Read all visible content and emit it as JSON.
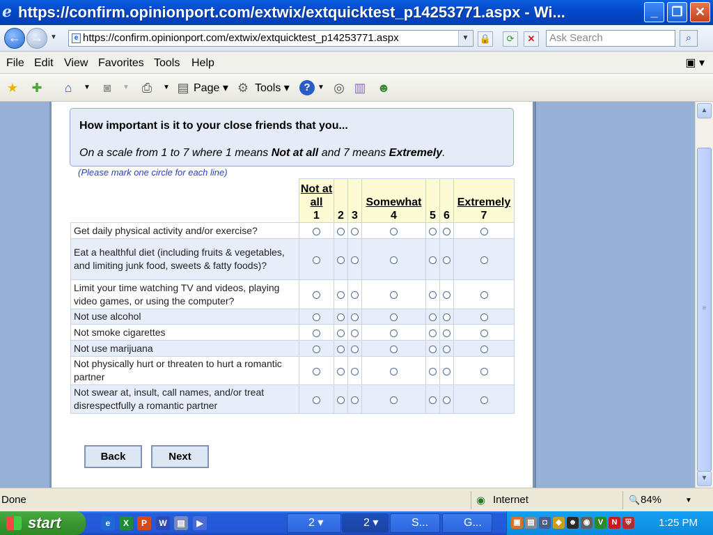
{
  "window": {
    "title": "https://confirm.opinionport.com/extwix/extquicktest_p14253771.aspx - Wi..."
  },
  "address_bar": {
    "url": "https://confirm.opinionport.com/extwix/extquicktest_p14253771.aspx",
    "search_placeholder": "Ask Search"
  },
  "menu": [
    "File",
    "Edit",
    "View",
    "Favorites",
    "Tools",
    "Help"
  ],
  "toolbar": {
    "page_label": "Page",
    "tools_label": "Tools"
  },
  "survey": {
    "question": "How important is it to your close friends that you...",
    "scale_prefix": "On a scale from 1 to 7 where 1 means ",
    "scale_low": "Not at all",
    "scale_mid": " and 7 means ",
    "scale_high": "Extremely",
    "scale_end": ".",
    "instruction": "(Please mark one circle for each line)",
    "columns": [
      {
        "label": "Not at all",
        "value": "1"
      },
      {
        "label": "",
        "value": "2"
      },
      {
        "label": "",
        "value": "3"
      },
      {
        "label": "Somewhat",
        "value": "4"
      },
      {
        "label": "",
        "value": "5"
      },
      {
        "label": "",
        "value": "6"
      },
      {
        "label": "Extremely",
        "value": "7"
      }
    ],
    "items": [
      "Get daily physical activity and/or exercise?",
      "Eat a healthful diet (including fruits & vegetables, and limiting junk food, sweets & fatty foods)?",
      "Limit your time watching TV and videos, playing video games, or using the computer?",
      "Not use alcohol",
      "Not smoke cigarettes",
      "Not use marijuana",
      "Not physically hurt or threaten to hurt a romantic partner",
      "Not swear at, insult, call names, and/or treat disrespectfully a romantic partner"
    ],
    "back_label": "Back",
    "next_label": "Next"
  },
  "status": {
    "text": "Done",
    "zone": "Internet",
    "zoom": "84%"
  },
  "taskbar": {
    "start_label": "start",
    "tasks": [
      "2",
      "2",
      "S...",
      "G..."
    ],
    "clock": "1:25 PM"
  },
  "icons": [
    "ie-logo-icon",
    "back-arrow-icon",
    "forward-arrow-icon",
    "lock-icon",
    "refresh-icon",
    "stop-icon",
    "search-icon",
    "favorites-star-icon",
    "add-favorites-icon",
    "home-icon",
    "rss-feed-icon",
    "print-icon",
    "page-icon",
    "gear-icon",
    "help-icon",
    "research-icon",
    "messenger-icon"
  ]
}
